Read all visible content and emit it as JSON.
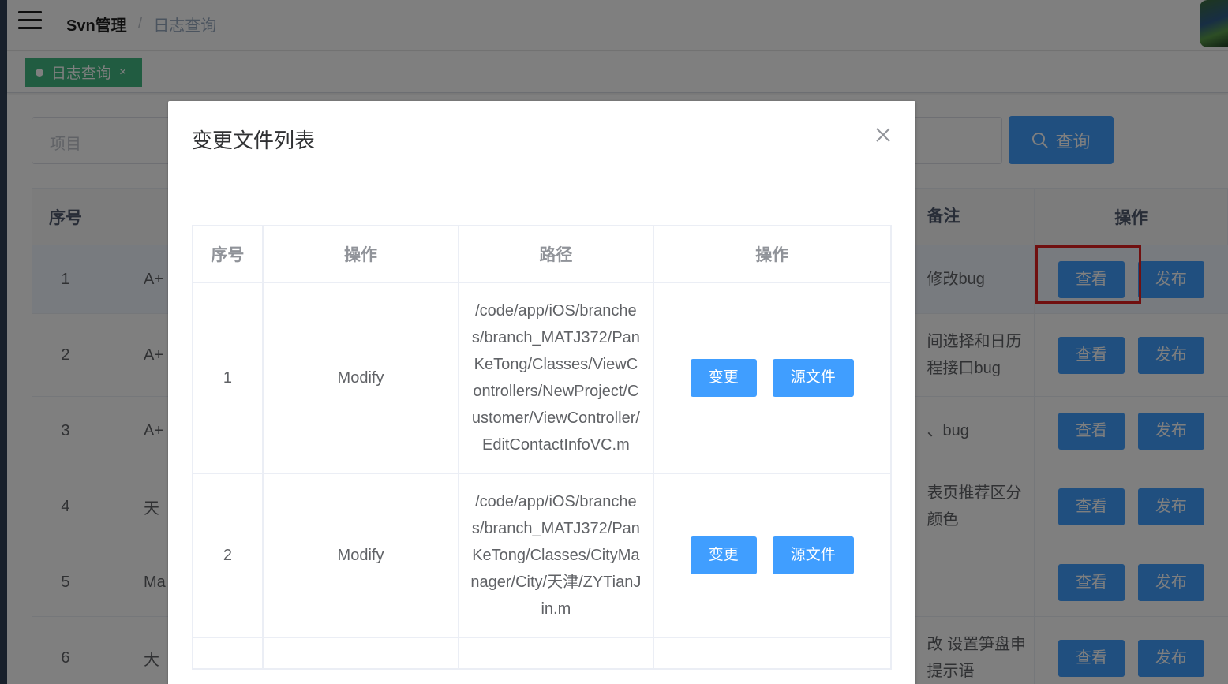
{
  "header": {
    "menu_icon": "hamburger-icon",
    "breadcrumb": [
      "Svn管理",
      "日志查询"
    ],
    "separator": "/"
  },
  "tags": [
    {
      "label": "日志查询",
      "close": "×"
    }
  ],
  "search": {
    "placeholder": "项目",
    "button_label": "查询",
    "button_icon": "search-icon"
  },
  "log_table": {
    "headers": {
      "index": "序号",
      "remark": "备注",
      "ops": "操作"
    },
    "view_label": "查看",
    "publish_label": "发布",
    "rows": [
      {
        "index": "1",
        "project": "A+",
        "remark": "修改bug"
      },
      {
        "index": "2",
        "project": "A+",
        "remark": "间选择和日历 程接口bug"
      },
      {
        "index": "3",
        "project": "A+",
        "remark": "、bug"
      },
      {
        "index": "4",
        "project": "天",
        "remark": "表页推荐区分 颜色"
      },
      {
        "index": "5",
        "project": "Ma",
        "remark": ""
      },
      {
        "index": "6",
        "project": "大",
        "remark": "改 设置笋盘申 提示语"
      }
    ]
  },
  "dialog": {
    "title": "变更文件列表",
    "close_icon": "close-icon",
    "headers": [
      "序号",
      "操作",
      "路径",
      "操作"
    ],
    "change_label": "变更",
    "source_label": "源文件",
    "rows": [
      {
        "index": "1",
        "action": "Modify",
        "path": "/code/app/iOS/branches/branch_MATJ372/PanKeTong/Classes/ViewControllers/NewProject/Customer/ViewController/EditContactInfoVC.m"
      },
      {
        "index": "2",
        "action": "Modify",
        "path": "/code/app/iOS/branches/branch_MATJ372/PanKeTong/Classes/CityManager/City/天津/ZYTianJin.m"
      }
    ]
  },
  "colors": {
    "primary": "#409eff",
    "tag_active": "#42b983",
    "highlight": "#e02020",
    "sidebar": "#304156"
  }
}
